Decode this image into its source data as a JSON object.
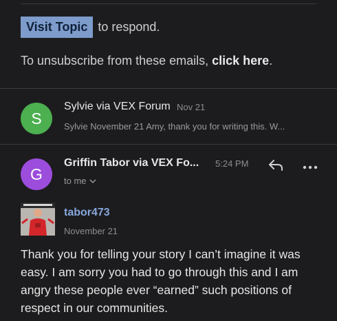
{
  "email_footer": {
    "visit_topic_label": "Visit Topic",
    "respond_text": "to respond.",
    "unsubscribe_text": "To unsubscribe from these emails,",
    "unsubscribe_link": "click here",
    "unsubscribe_end": "."
  },
  "thread": [
    {
      "avatar_letter": "S",
      "avatar_color": "#4caf50",
      "sender": "Sylvie via VEX Forum",
      "date": "Nov 21",
      "preview": "Sylvie November 21 Amy, thank you for writing this. W..."
    },
    {
      "avatar_letter": "G",
      "avatar_color": "#9c4ddc",
      "sender": "Griffin Tabor  via VEX Fo...",
      "time": "5:24 PM",
      "recipient": "to me"
    }
  ],
  "post": {
    "username": "tabor473",
    "date": "November 21",
    "body": "Thank you for telling your story I can’t imagine it was easy. I am sorry you had to go through this and I am angry these people ever “earned” such positions of respect in our communities."
  },
  "icons": {
    "reply": "reply-arrow-icon",
    "more": "more-ellipsis-icon",
    "chevron": "chevron-down-icon"
  }
}
